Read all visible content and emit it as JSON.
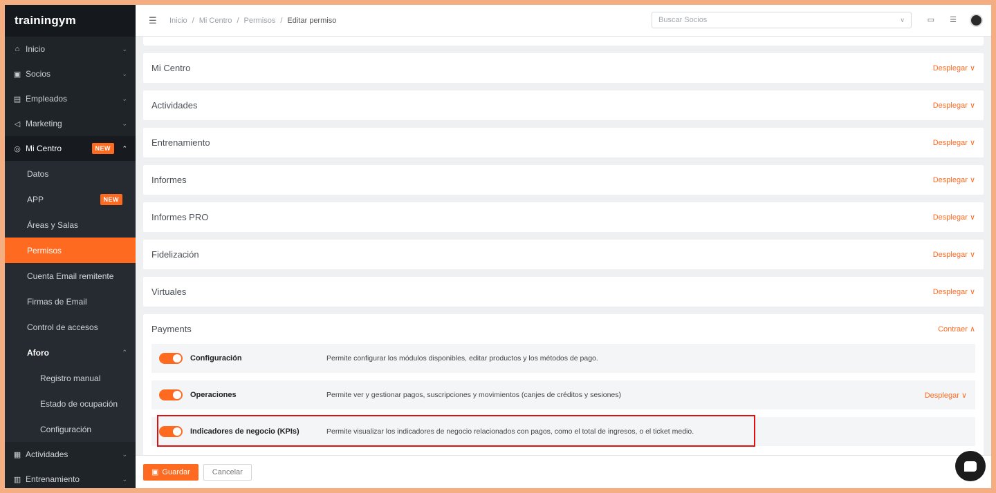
{
  "brand": {
    "logo_text": "trainingym"
  },
  "sidebar": {
    "items": [
      {
        "label": "Inicio",
        "icon": "home-icon"
      },
      {
        "label": "Socios",
        "icon": "id-card-icon"
      },
      {
        "label": "Empleados",
        "icon": "badge-icon"
      },
      {
        "label": "Marketing",
        "icon": "megaphone-icon"
      },
      {
        "label": "Mi Centro",
        "icon": "location-icon",
        "badge": "NEW"
      }
    ],
    "mi_centro_sub": [
      {
        "label": "Datos"
      },
      {
        "label": "APP",
        "badge": "NEW"
      },
      {
        "label": "Áreas y Salas"
      },
      {
        "label": "Permisos"
      },
      {
        "label": "Cuenta Email remitente"
      },
      {
        "label": "Firmas de Email"
      },
      {
        "label": "Control de accesos"
      },
      {
        "label": "Aforo"
      }
    ],
    "aforo_sub": [
      {
        "label": "Registro manual"
      },
      {
        "label": "Estado de ocupación"
      },
      {
        "label": "Configuración"
      }
    ],
    "bottom_items": [
      {
        "label": "Actividades",
        "icon": "calendar-icon"
      },
      {
        "label": "Entrenamiento",
        "icon": "clipboard-icon"
      }
    ]
  },
  "topbar": {
    "breadcrumb": [
      "Inicio",
      "Mi Centro",
      "Permisos",
      "Editar permiso"
    ],
    "search_placeholder": "Buscar Socios"
  },
  "panels": [
    {
      "title": "Mi Centro",
      "action": "Desplegar"
    },
    {
      "title": "Actividades",
      "action": "Desplegar"
    },
    {
      "title": "Entrenamiento",
      "action": "Desplegar"
    },
    {
      "title": "Informes",
      "action": "Desplegar"
    },
    {
      "title": "Informes PRO",
      "action": "Desplegar"
    },
    {
      "title": "Fidelización",
      "action": "Desplegar"
    },
    {
      "title": "Virtuales",
      "action": "Desplegar"
    }
  ],
  "payments": {
    "title": "Payments",
    "action": "Contraer",
    "permissions": [
      {
        "name": "Configuración",
        "description": "Permite configurar los módulos disponibles, editar productos y los métodos de pago.",
        "enabled": true
      },
      {
        "name": "Operaciones",
        "description": "Permite ver y gestionar pagos, suscripciones y movimientos (canjes de créditos y sesiones)",
        "enabled": true,
        "action": "Desplegar"
      },
      {
        "name": "Indicadores de negocio (KPIs)",
        "description": "Permite visualizar los indicadores de negocio relacionados con pagos, como el total de ingresos, o el ticket medio.",
        "enabled": true
      }
    ]
  },
  "footer": {
    "save_label": "Guardar",
    "cancel_label": "Cancelar"
  },
  "colors": {
    "accent": "#ff6a21",
    "sidebar_bg": "#1f2429",
    "highlight": "#e01010"
  }
}
